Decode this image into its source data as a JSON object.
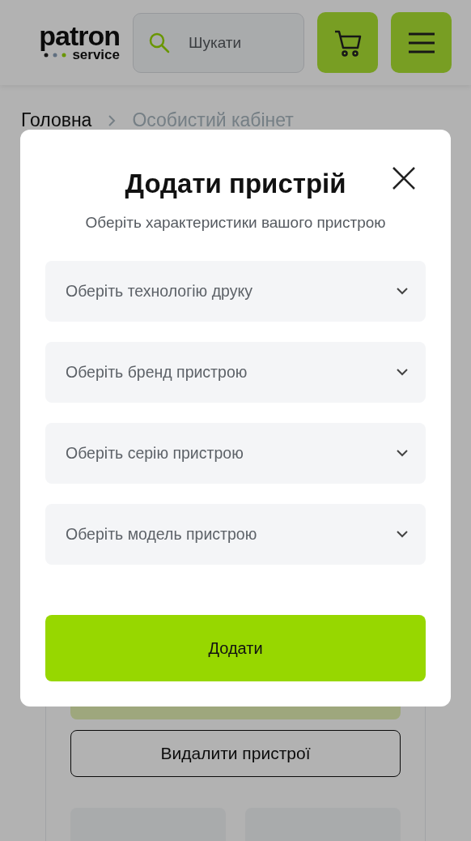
{
  "header": {
    "logo": {
      "word": "patron",
      "sub": "service"
    },
    "search": {
      "placeholder": "Шукати"
    }
  },
  "breadcrumbs": [
    {
      "label": "Головна",
      "selected": false
    },
    {
      "label": "Особистий кабінет",
      "selected": true
    }
  ],
  "page": {
    "delete_button": "Видалити пристрої"
  },
  "modal": {
    "title": "Додати пристрій",
    "subtitle": "Оберіть характеристики вашого пристрою",
    "selects": [
      {
        "placeholder": "Оберіть технологію друку"
      },
      {
        "placeholder": "Оберіть бренд пристрою"
      },
      {
        "placeholder": "Оберіть серію пристрою"
      },
      {
        "placeholder": "Оберіть модель пристрою"
      }
    ],
    "submit": "Додати"
  }
}
